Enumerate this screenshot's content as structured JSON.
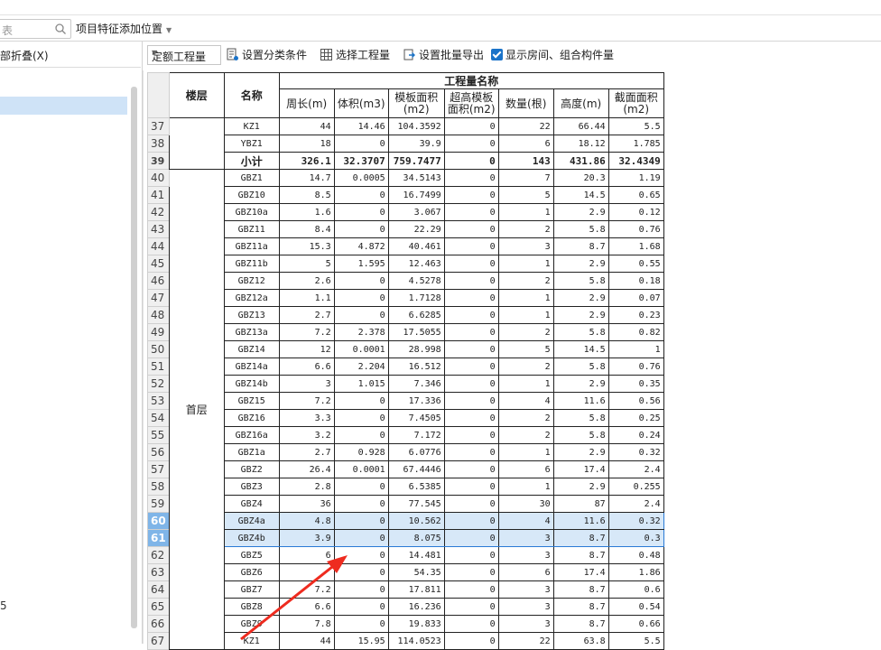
{
  "search": {
    "placeholder": "表"
  },
  "feature_position": {
    "label": "项目特征添加位置"
  },
  "left_panel": {
    "header": "部折叠(X)",
    "bottom_text": "5"
  },
  "toolbar": {
    "quota_select": "定额工程量",
    "set_category": "设置分类条件",
    "select_quantity": "选择工程量",
    "batch_export": "设置批量导出",
    "show_rooms": "显示房间、组合构件量"
  },
  "table": {
    "headers": {
      "floor": "楼层",
      "name": "名称",
      "group": "工程量名称",
      "perimeter": "周长(m)",
      "volume": "体积(m3)",
      "formwork": "模板面积(m2)",
      "high_formwork": "超高模板面积(m2)",
      "count": "数量(根)",
      "height": "高度(m)",
      "section": "截面面积(m2)"
    },
    "floor_first": "首层",
    "rows": [
      {
        "n": "37",
        "name": "KZ1",
        "p": "44",
        "v": "14.46",
        "f": "104.3592",
        "h": "0",
        "c": "22",
        "ht": "66.44",
        "s": "5.5"
      },
      {
        "n": "38",
        "name": "YBZ1",
        "p": "18",
        "v": "0",
        "f": "39.9",
        "h": "0",
        "c": "6",
        "ht": "18.12",
        "s": "1.785"
      },
      {
        "n": "39",
        "name": "小计",
        "p": "326.1",
        "v": "32.3707",
        "f": "759.7477",
        "h": "0",
        "c": "143",
        "ht": "431.86",
        "s": "32.4349",
        "sub": true
      },
      {
        "n": "40",
        "name": "GBZ1",
        "p": "14.7",
        "v": "0.0005",
        "f": "34.5143",
        "h": "0",
        "c": "7",
        "ht": "20.3",
        "s": "1.19"
      },
      {
        "n": "41",
        "name": "GBZ10",
        "p": "8.5",
        "v": "0",
        "f": "16.7499",
        "h": "0",
        "c": "5",
        "ht": "14.5",
        "s": "0.65"
      },
      {
        "n": "42",
        "name": "GBZ10a",
        "p": "1.6",
        "v": "0",
        "f": "3.067",
        "h": "0",
        "c": "1",
        "ht": "2.9",
        "s": "0.12"
      },
      {
        "n": "43",
        "name": "GBZ11",
        "p": "8.4",
        "v": "0",
        "f": "22.29",
        "h": "0",
        "c": "2",
        "ht": "5.8",
        "s": "0.76"
      },
      {
        "n": "44",
        "name": "GBZ11a",
        "p": "15.3",
        "v": "4.872",
        "f": "40.461",
        "h": "0",
        "c": "3",
        "ht": "8.7",
        "s": "1.68"
      },
      {
        "n": "45",
        "name": "GBZ11b",
        "p": "5",
        "v": "1.595",
        "f": "12.463",
        "h": "0",
        "c": "1",
        "ht": "2.9",
        "s": "0.55"
      },
      {
        "n": "46",
        "name": "GBZ12",
        "p": "2.6",
        "v": "0",
        "f": "4.5278",
        "h": "0",
        "c": "2",
        "ht": "5.8",
        "s": "0.18"
      },
      {
        "n": "47",
        "name": "GBZ12a",
        "p": "1.1",
        "v": "0",
        "f": "1.7128",
        "h": "0",
        "c": "1",
        "ht": "2.9",
        "s": "0.07"
      },
      {
        "n": "48",
        "name": "GBZ13",
        "p": "2.7",
        "v": "0",
        "f": "6.6285",
        "h": "0",
        "c": "1",
        "ht": "2.9",
        "s": "0.23"
      },
      {
        "n": "49",
        "name": "GBZ13a",
        "p": "7.2",
        "v": "2.378",
        "f": "17.5055",
        "h": "0",
        "c": "2",
        "ht": "5.8",
        "s": "0.82"
      },
      {
        "n": "50",
        "name": "GBZ14",
        "p": "12",
        "v": "0.0001",
        "f": "28.998",
        "h": "0",
        "c": "5",
        "ht": "14.5",
        "s": "1"
      },
      {
        "n": "51",
        "name": "GBZ14a",
        "p": "6.6",
        "v": "2.204",
        "f": "16.512",
        "h": "0",
        "c": "2",
        "ht": "5.8",
        "s": "0.76"
      },
      {
        "n": "52",
        "name": "GBZ14b",
        "p": "3",
        "v": "1.015",
        "f": "7.346",
        "h": "0",
        "c": "1",
        "ht": "2.9",
        "s": "0.35"
      },
      {
        "n": "53",
        "name": "GBZ15",
        "p": "7.2",
        "v": "0",
        "f": "17.336",
        "h": "0",
        "c": "4",
        "ht": "11.6",
        "s": "0.56"
      },
      {
        "n": "54",
        "name": "GBZ16",
        "p": "3.3",
        "v": "0",
        "f": "7.4505",
        "h": "0",
        "c": "2",
        "ht": "5.8",
        "s": "0.25"
      },
      {
        "n": "55",
        "name": "GBZ16a",
        "p": "3.2",
        "v": "0",
        "f": "7.172",
        "h": "0",
        "c": "2",
        "ht": "5.8",
        "s": "0.24"
      },
      {
        "n": "56",
        "name": "GBZ1a",
        "p": "2.7",
        "v": "0.928",
        "f": "6.0776",
        "h": "0",
        "c": "1",
        "ht": "2.9",
        "s": "0.32"
      },
      {
        "n": "57",
        "name": "GBZ2",
        "p": "26.4",
        "v": "0.0001",
        "f": "67.4446",
        "h": "0",
        "c": "6",
        "ht": "17.4",
        "s": "2.4"
      },
      {
        "n": "58",
        "name": "GBZ3",
        "p": "2.8",
        "v": "0",
        "f": "6.5385",
        "h": "0",
        "c": "1",
        "ht": "2.9",
        "s": "0.255"
      },
      {
        "n": "59",
        "name": "GBZ4",
        "p": "36",
        "v": "0",
        "f": "77.545",
        "h": "0",
        "c": "30",
        "ht": "87",
        "s": "2.4"
      },
      {
        "n": "60",
        "name": "GBZ4a",
        "p": "4.8",
        "v": "0",
        "f": "10.562",
        "h": "0",
        "c": "4",
        "ht": "11.6",
        "s": "0.32",
        "hl": "top"
      },
      {
        "n": "61",
        "name": "GBZ4b",
        "p": "3.9",
        "v": "0",
        "f": "8.075",
        "h": "0",
        "c": "3",
        "ht": "8.7",
        "s": "0.3",
        "hl": "bot"
      },
      {
        "n": "62",
        "name": "GBZ5",
        "p": "6",
        "v": "0",
        "f": "14.481",
        "h": "0",
        "c": "3",
        "ht": "8.7",
        "s": "0.48"
      },
      {
        "n": "63",
        "name": "GBZ6",
        "p": "",
        "v": "0",
        "f": "54.35",
        "h": "0",
        "c": "6",
        "ht": "17.4",
        "s": "1.86"
      },
      {
        "n": "64",
        "name": "GBZ7",
        "p": "7.2",
        "v": "0",
        "f": "17.811",
        "h": "0",
        "c": "3",
        "ht": "8.7",
        "s": "0.6"
      },
      {
        "n": "65",
        "name": "GBZ8",
        "p": "6.6",
        "v": "0",
        "f": "16.236",
        "h": "0",
        "c": "3",
        "ht": "8.7",
        "s": "0.54"
      },
      {
        "n": "66",
        "name": "GBZ9",
        "p": "7.8",
        "v": "0",
        "f": "19.833",
        "h": "0",
        "c": "3",
        "ht": "8.7",
        "s": "0.66"
      },
      {
        "n": "67",
        "name": "KZ1",
        "p": "44",
        "v": "15.95",
        "f": "114.0523",
        "h": "0",
        "c": "22",
        "ht": "63.8",
        "s": "5.5"
      }
    ]
  },
  "colors": {
    "selection": "#d7e8f8",
    "selection_border": "#2a7ad5",
    "arrow": "#ee2b1f",
    "accent": "#1a73c9"
  }
}
